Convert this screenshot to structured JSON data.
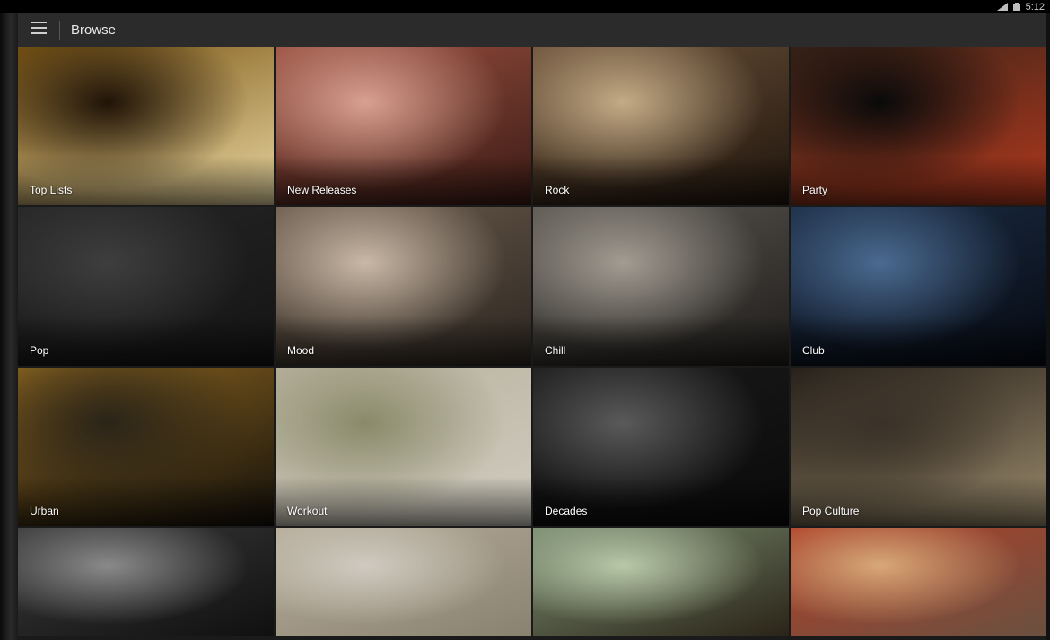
{
  "status_bar": {
    "time": "5:12"
  },
  "action_bar": {
    "title": "Browse"
  },
  "tiles": [
    {
      "label": "Top Lists",
      "colors": [
        "#201408",
        "#7a5412",
        "#e8d6a0"
      ]
    },
    {
      "label": "New Releases",
      "colors": [
        "#d8a090",
        "#9a5040",
        "#3a1a14"
      ]
    },
    {
      "label": "Rock",
      "colors": [
        "#c4ab86",
        "#6a5038",
        "#1e140c"
      ]
    },
    {
      "label": "Party",
      "colors": [
        "#0a0a0a",
        "#3a2418",
        "#b0381e"
      ]
    },
    {
      "label": "Pop",
      "colors": [
        "#3e3e3e",
        "#262626",
        "#141414"
      ]
    },
    {
      "label": "Mood",
      "colors": [
        "#c9b8a6",
        "#6a5a4c",
        "#2c2620"
      ]
    },
    {
      "label": "Chill",
      "colors": [
        "#a29c92",
        "#5a5650",
        "#1e1c1a"
      ]
    },
    {
      "label": "Club",
      "colors": [
        "#4a6a90",
        "#1c2c44",
        "#060a12"
      ]
    },
    {
      "label": "Urban",
      "colors": [
        "#2a2418",
        "#8a6420",
        "#14100a"
      ]
    },
    {
      "label": "Workout",
      "colors": [
        "#8a8a6a",
        "#b8b29e",
        "#d0ccc0"
      ]
    },
    {
      "label": "Decades",
      "colors": [
        "#5a5a5a",
        "#1a1a1a",
        "#0a0a0a"
      ]
    },
    {
      "label": "Pop Culture",
      "colors": [
        "#3a3228",
        "#241e18",
        "#9a8a6c"
      ]
    },
    {
      "label": "",
      "colors": [
        "#8a8a8a",
        "#3a3a3a",
        "#101010"
      ]
    },
    {
      "label": "",
      "colors": [
        "#cfcac0",
        "#b6ad9a",
        "#8a8270"
      ]
    },
    {
      "label": "",
      "colors": [
        "#b8c8a8",
        "#7a8c70",
        "#2a2418"
      ]
    },
    {
      "label": "",
      "colors": [
        "#d8a878",
        "#b04028",
        "#6a5040"
      ]
    }
  ]
}
